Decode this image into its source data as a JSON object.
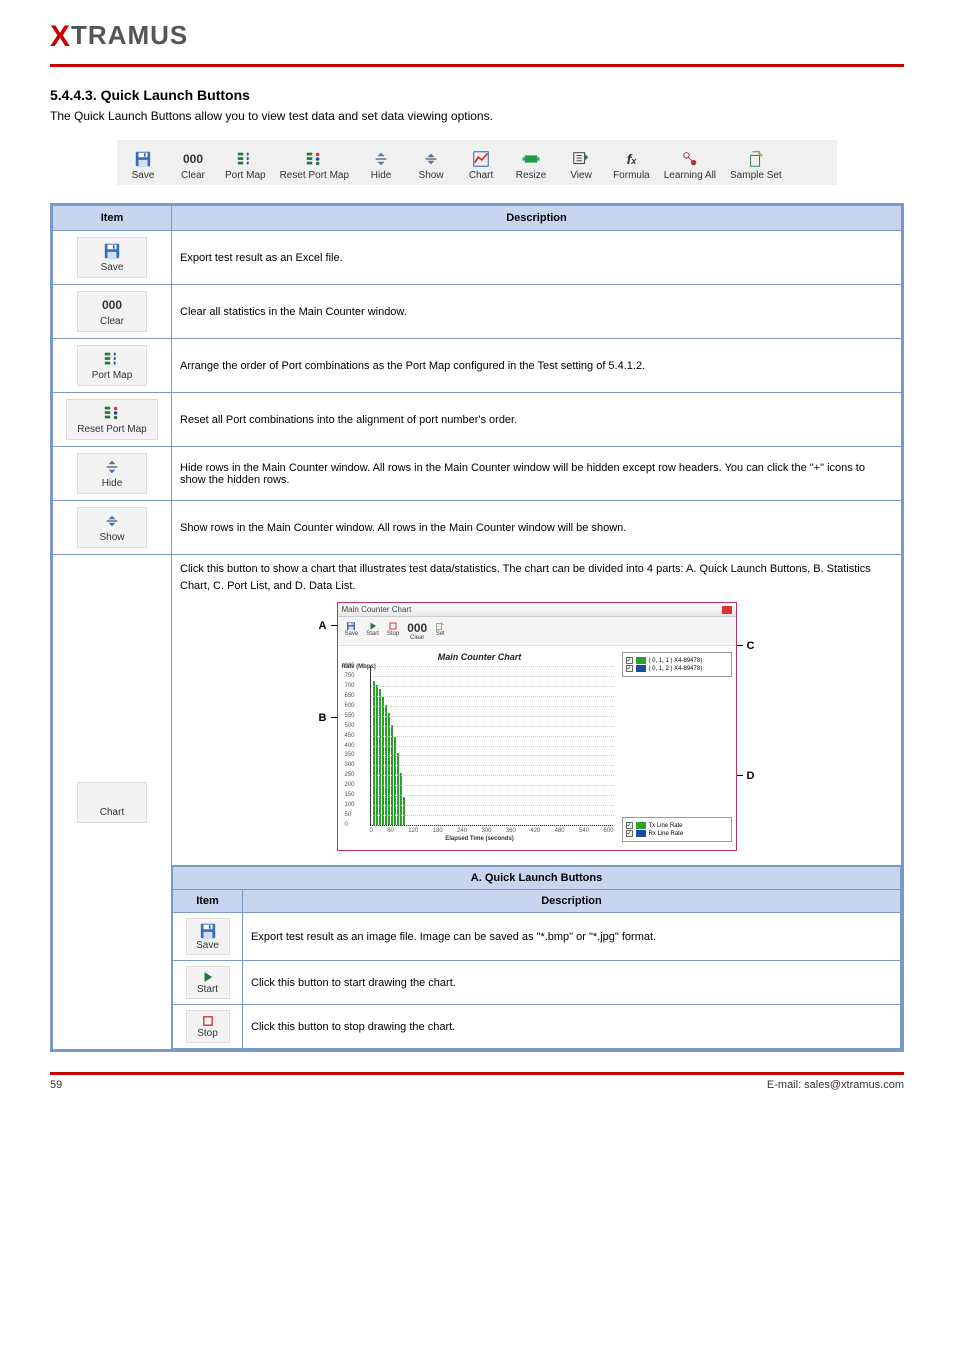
{
  "logo": "XTRAMUS",
  "section_heading": "5.4.4.3. Quick Launch Buttons",
  "intro": "The Quick Launch Buttons allow you to view test data and set data viewing options.",
  "toolbar": [
    {
      "name": "save",
      "label": "Save",
      "icon": "save-icon"
    },
    {
      "name": "clear",
      "label": "Clear",
      "icon": "clear-icon"
    },
    {
      "name": "portmap",
      "label": "Port Map",
      "icon": "portmap-icon"
    },
    {
      "name": "resetportmap",
      "label": "Reset Port Map",
      "icon": "resetportmap-icon"
    },
    {
      "name": "hide",
      "label": "Hide",
      "icon": "hide-icon"
    },
    {
      "name": "show",
      "label": "Show",
      "icon": "show-icon"
    },
    {
      "name": "chart",
      "label": "Chart",
      "icon": "chart-icon"
    },
    {
      "name": "resize",
      "label": "Resize",
      "icon": "resize-icon"
    },
    {
      "name": "view",
      "label": "View",
      "icon": "view-icon"
    },
    {
      "name": "formula",
      "label": "Formula",
      "icon": "formula-icon"
    },
    {
      "name": "learningall",
      "label": "Learning All",
      "icon": "learning-icon"
    },
    {
      "name": "sampleset",
      "label": "Sample Set",
      "icon": "sampleset-icon"
    }
  ],
  "table_headers": {
    "item": "Item",
    "description": "Description"
  },
  "rows": [
    {
      "key": "save",
      "label": "Save",
      "icon": "save-icon",
      "desc": "Export test result as an Excel file."
    },
    {
      "key": "clear",
      "label": "Clear",
      "icon": "clear-icon",
      "desc": "Clear all statistics in the Main Counter window."
    },
    {
      "key": "portmap",
      "label": "Port Map",
      "icon": "portmap-icon",
      "desc": "Arrange the order of Port combinations as the Port Map configured in the Test setting of 5.4.1.2."
    },
    {
      "key": "resetportmap",
      "label": "Reset Port Map",
      "icon": "resetportmap-icon",
      "desc": "Reset all Port combinations into the alignment of port number's order."
    },
    {
      "key": "hide",
      "label": "Hide",
      "icon": "hide-icon",
      "desc": "Hide rows in the Main Counter window. All rows in the Main Counter window will be hidden except row headers. You can click the \"+\" icons to show the hidden rows."
    },
    {
      "key": "show",
      "label": "Show",
      "icon": "show-icon",
      "desc": "Show rows in the Main Counter window. All rows in the Main Counter window will be shown."
    }
  ],
  "chart_row": {
    "label": "Chart",
    "icon": "chart-icon",
    "intro": "Click this button to show a chart that illustrates test data/statistics. The chart can be divided into 4 parts: A. Quick Launch Buttons, B. Statistics Chart, C. Port List, and D. Data List.",
    "section_header": "A. Quick Launch Buttons",
    "inner_headers": {
      "item": "Item",
      "description": "Description"
    },
    "inner_rows": [
      {
        "key": "save",
        "label": "Save",
        "icon": "save-icon",
        "desc": "Export test result as an image file. Image can be saved as \"*.bmp\" or \"*.jpg\" format."
      },
      {
        "key": "start",
        "label": "Start",
        "icon": "start-icon",
        "desc": "Click this button to start drawing the chart."
      },
      {
        "key": "stop",
        "label": "Stop",
        "icon": "stop-icon",
        "desc": "Click this button to stop drawing the chart."
      }
    ]
  },
  "chart_window": {
    "title": "Main Counter Chart",
    "toolbar": [
      {
        "label": "Save",
        "icon": "save-icon"
      },
      {
        "label": "Start",
        "icon": "start-icon"
      },
      {
        "label": "Stop",
        "icon": "stop-icon"
      },
      {
        "label": "Clear",
        "icon": "clear-icon"
      },
      {
        "label": "Set",
        "icon": "set-icon"
      }
    ],
    "main_title": "Main Counter Chart",
    "y_axis_title": "Rate (Mbps)",
    "x_axis_title": "Elapsed Time (seconds)",
    "port_list": [
      {
        "checked": true,
        "color": "#2aa12a",
        "label": "( 0, 1, 1 ) X4-89478)"
      },
      {
        "checked": true,
        "color": "#1b4aa0",
        "label": "( 0, 1, 2 ) X4-89478)"
      }
    ],
    "data_list": [
      {
        "checked": true,
        "color": "#2aa12a",
        "label": "Tx Line Rate"
      },
      {
        "checked": true,
        "color": "#1b4aa0",
        "label": "Rx Line Rate"
      }
    ],
    "callouts": {
      "A": "A",
      "B": "B",
      "C": "C",
      "D": "D"
    }
  },
  "chart_data": {
    "type": "bar",
    "title": "Main Counter Chart",
    "xlabel": "Elapsed Time (seconds)",
    "ylabel": "Rate (Mbps)",
    "xlim": [
      0,
      600
    ],
    "ylim": [
      0,
      800
    ],
    "x_ticks": [
      0,
      60,
      120,
      180,
      240,
      300,
      360,
      420,
      480,
      540,
      600
    ],
    "y_ticks": [
      0,
      50,
      100,
      150,
      200,
      250,
      300,
      350,
      400,
      450,
      500,
      550,
      600,
      650,
      700,
      750,
      800
    ],
    "series": [
      {
        "name": "Tx Line Rate",
        "color": "#2aa12a",
        "x": [
          2,
          4,
          6,
          8,
          10,
          12,
          14,
          16,
          18,
          20,
          22
        ],
        "values": [
          720,
          700,
          680,
          640,
          600,
          560,
          500,
          440,
          360,
          260,
          140
        ]
      }
    ]
  },
  "footer": {
    "left": "59",
    "right": "E-mail: sales@xtramus.com"
  }
}
